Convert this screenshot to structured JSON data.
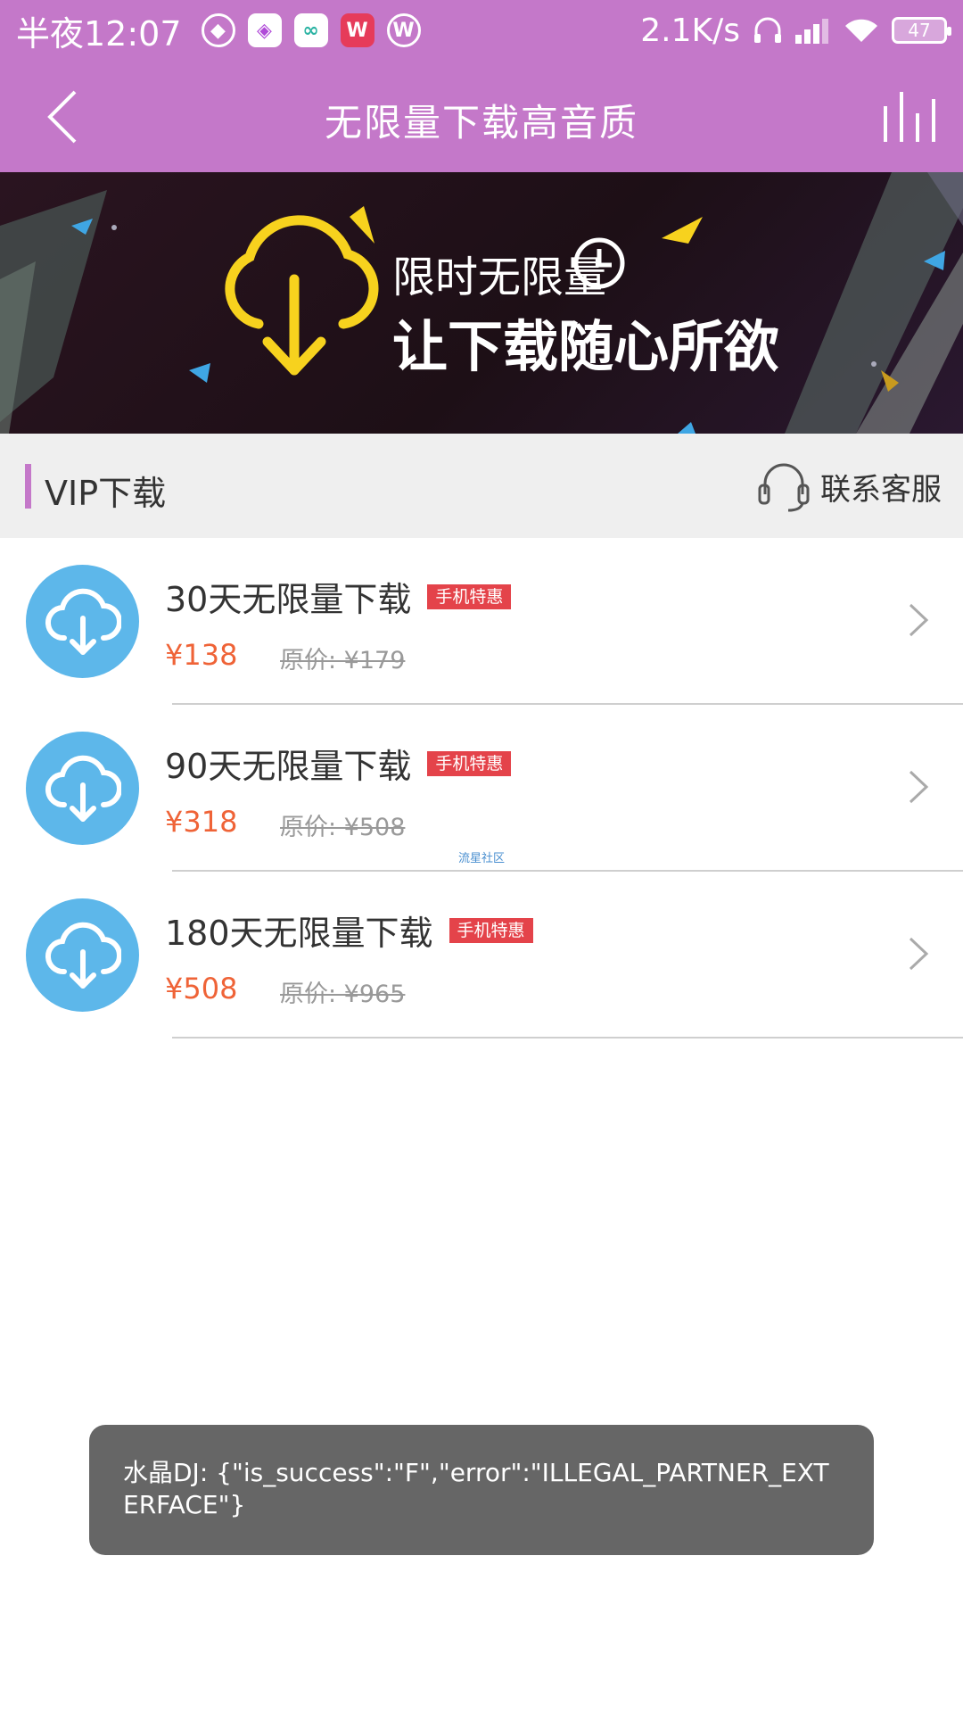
{
  "status_bar": {
    "time": "半夜12:07",
    "net_speed": "2.1K/s",
    "battery": "47",
    "icons": [
      "gem-icon",
      "cloud-app-icon",
      "circles-app-icon",
      "w-app-icon",
      "w-outline-app-icon",
      "headphones-icon",
      "signal-icon",
      "wifi-icon",
      "battery-icon"
    ]
  },
  "header": {
    "title": "无限量下载高音质",
    "back_icon": "chevron-left-icon",
    "equalizer_icon": "equalizer-icon"
  },
  "banner": {
    "line1": "限时无限量",
    "line2": "让下载随心所欲",
    "colors": {
      "cloud": "#f7d21e",
      "accent_blue": "#3fa6e4"
    }
  },
  "section": {
    "title": "VIP下载",
    "contact_label": "联系客服"
  },
  "plans": [
    {
      "title": "30天无限量下载",
      "tag": "手机特惠",
      "price": "¥138",
      "original_price": "原价: ¥179"
    },
    {
      "title": "90天无限量下载",
      "tag": "手机特惠",
      "price": "¥318",
      "original_price": "原价: ¥508"
    },
    {
      "title": "180天无限量下载",
      "tag": "手机特惠",
      "price": "¥508",
      "original_price": "原价: ¥965"
    }
  ],
  "watermark": "流星社区",
  "toast": {
    "message": "水晶DJ: {\"is_success\":\"F\",\"error\":\"ILLEGAL_PARTNER_EXTERFACE\"}"
  },
  "colors": {
    "primary": "#c478c9",
    "price": "#ef6337",
    "tag": "#e4434a",
    "icon_bg": "#5db7ea"
  }
}
